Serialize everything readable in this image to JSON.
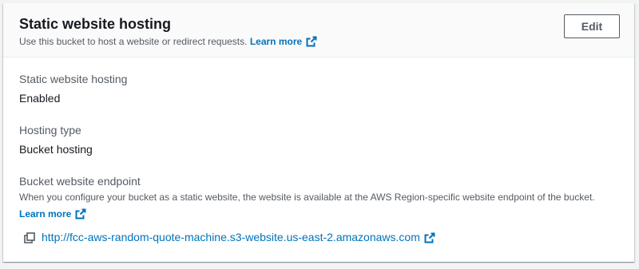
{
  "header": {
    "title": "Static website hosting",
    "description": "Use this bucket to host a website or redirect requests.",
    "learn_more": "Learn more",
    "edit_label": "Edit"
  },
  "fields": {
    "hosting": {
      "label": "Static website hosting",
      "value": "Enabled"
    },
    "type": {
      "label": "Hosting type",
      "value": "Bucket hosting"
    },
    "endpoint": {
      "label": "Bucket website endpoint",
      "description": "When you configure your bucket as a static website, the website is available at the AWS Region-specific website endpoint of the bucket.",
      "learn_more": "Learn more",
      "url": "http://fcc-aws-random-quote-machine.s3-website.us-east-2.amazonaws.com"
    }
  },
  "icons": {
    "external_link": "external-link-icon",
    "copy": "copy-icon"
  },
  "colors": {
    "link": "#0073bb",
    "text": "#16191f",
    "secondary_text": "#545b64",
    "header_bg": "#fafafa",
    "page_bg": "#f2f3f3"
  }
}
